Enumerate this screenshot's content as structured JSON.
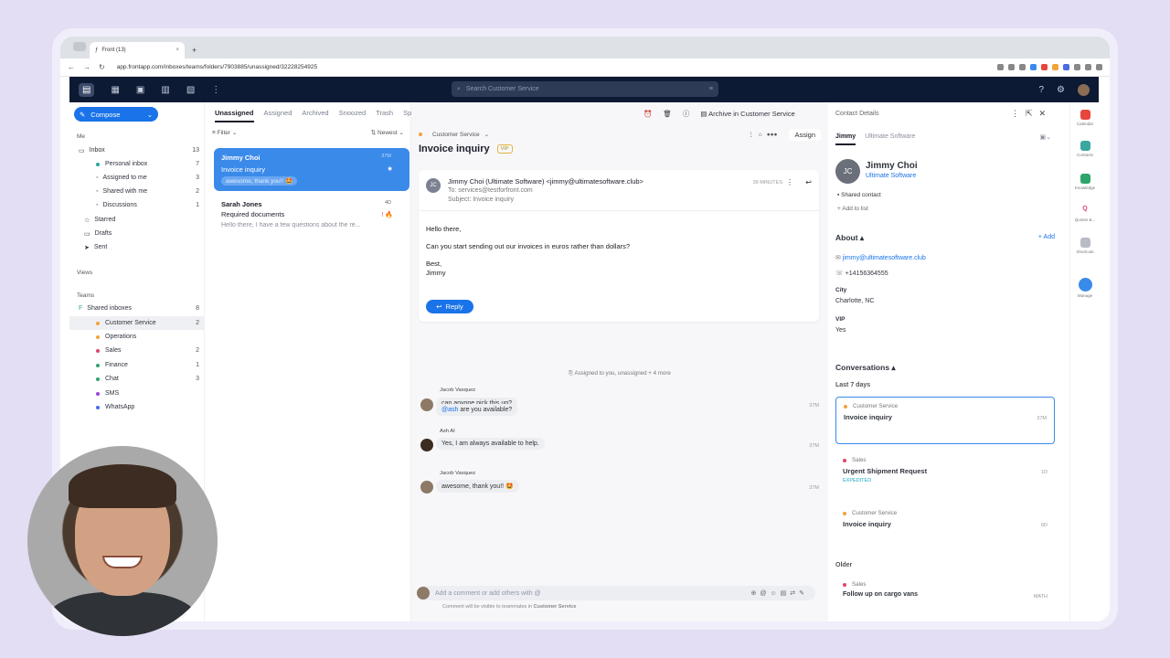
{
  "browser": {
    "tab_title": "Front (13)",
    "url": "app.frontapp.com/inboxes/teams/folders/7903885/unassigned/32228254925"
  },
  "search": {
    "placeholder": "Search Customer Service"
  },
  "sidebar": {
    "compose_label": "Compose",
    "me_label": "Me",
    "items": [
      {
        "label": "Inbox",
        "count": "13"
      },
      {
        "label": "Personal inbox",
        "count": "7",
        "color": "#25a9a0"
      },
      {
        "label": "Assigned to me",
        "count": "3"
      },
      {
        "label": "Shared with me",
        "count": "2"
      },
      {
        "label": "Discussions",
        "count": "1"
      },
      {
        "label": "Starred",
        "count": ""
      },
      {
        "label": "Drafts",
        "count": ""
      },
      {
        "label": "Sent",
        "count": ""
      }
    ],
    "views_label": "Views",
    "teams_label": "Teams",
    "shared_inboxes": {
      "label": "Shared inboxes",
      "count": "8"
    },
    "team_items": [
      {
        "label": "Customer Service",
        "count": "2",
        "color": "#f2a33a"
      },
      {
        "label": "Operations",
        "count": "",
        "color": "#f2a33a"
      },
      {
        "label": "Sales",
        "count": "2",
        "color": "#e0466a"
      },
      {
        "label": "Finance",
        "count": "1",
        "color": "#2ea56b"
      },
      {
        "label": "Chat",
        "count": "3",
        "color": "#2ea56b"
      },
      {
        "label": "SMS",
        "count": "",
        "color": "#9b44d6"
      },
      {
        "label": "WhatsApp",
        "count": "",
        "color": "#4a6be6"
      }
    ]
  },
  "tabs": [
    "Unassigned",
    "Assigned",
    "Archived",
    "Snoozed",
    "Trash",
    "Spam"
  ],
  "list": {
    "filter_label": "Filter",
    "sort_label": "Newest",
    "cards": [
      {
        "name": "Jimmy Choi",
        "subject": "Invoice inquiry",
        "preview": "awesome, thank you!! 🤩",
        "time": "37M"
      },
      {
        "name": "Sarah Jones",
        "subject": "Required documents",
        "preview": "Hello there, I have a few questions about the re...",
        "time": "4D"
      }
    ]
  },
  "toolbar": {
    "archive_label": "Archive in Customer Service",
    "assign_label": "Assign"
  },
  "conversation": {
    "inbox_label": "Customer Service",
    "title": "Invoice inquiry",
    "vip": "VIP",
    "email": {
      "avatar": "JC",
      "from": "Jimmy Choi (Ultimate Software) <jimmy@ultimatesoftware.club>",
      "to": "To: services@testforfront.com",
      "subject": "Subject: Invoice inquiry",
      "time": "39 MINUTES",
      "greeting": "Hello there,",
      "body": "Can you start sending out our invoices in euros rather than dollars?",
      "signoff": "Best,",
      "signature": "Jimmy"
    },
    "reply_label": "Reply",
    "system_message": "Assigned to you, unassigned + 4 more",
    "comments": [
      {
        "author": "Jacob Vasquez",
        "text": "can anyone pick this up?",
        "time": "37M"
      },
      {
        "author": "",
        "mention": "@ash",
        "text": " are you available?",
        "time": ""
      },
      {
        "author": "Ash AI",
        "text": "Yes, I am always available to help.",
        "time": "37M"
      },
      {
        "author": "Jacob Vasquez",
        "text": "awesome, thank you!! 🤩",
        "time": "37M"
      }
    ],
    "composer_placeholder": "Add a comment or add others with @",
    "visibility_note": "Comment will be visible to teammates in",
    "visibility_inbox": "Customer Service"
  },
  "contact": {
    "panel_title": "Contact Details",
    "tabs": [
      "Jimmy",
      "Ultimate Software"
    ],
    "avatar": "JC",
    "name": "Jimmy Choi",
    "company": "Ultimate Software",
    "shared": "Shared contact",
    "add_to_list": "+ Add to list",
    "about_label": "About",
    "add_label": "+ Add",
    "email": "jimmy@ultimatesoftware.club",
    "phone": "+14156364555",
    "city_label": "City",
    "city": "Charlotte, NC",
    "vip_label": "VIP",
    "vip_value": "Yes",
    "conversations_label": "Conversations",
    "last7_label": "Last 7 days",
    "older_label": "Older",
    "conversations": [
      {
        "inbox": "Customer Service",
        "subject": "Invoice inquiry",
        "time": "37M",
        "tag": "",
        "color": "#f2a33a"
      },
      {
        "inbox": "Sales",
        "subject": "Urgent Shipment Request",
        "time": "1D",
        "tag": "EXPEDITED",
        "color": "#e0466a"
      },
      {
        "inbox": "Customer Service",
        "subject": "Invoice inquiry",
        "time": "6D",
        "tag": "",
        "color": "#f2a33a"
      },
      {
        "inbox": "Sales",
        "subject": "Follow up on cargo vans",
        "time": "MATH",
        "tag": "",
        "color": "#e0466a"
      }
    ]
  },
  "rail": [
    {
      "label": "Calendar",
      "color": "#e8453c"
    },
    {
      "label": "Contacts",
      "color": "#3aa7a0"
    },
    {
      "label": "Knowledge",
      "color": "#2ea56b"
    },
    {
      "label": "Quotes &...",
      "color": "#e0466a"
    },
    {
      "label": "Shortcuts",
      "color": "#b9bcc4"
    },
    {
      "label": "Manage",
      "color": "#3a8aea"
    }
  ]
}
